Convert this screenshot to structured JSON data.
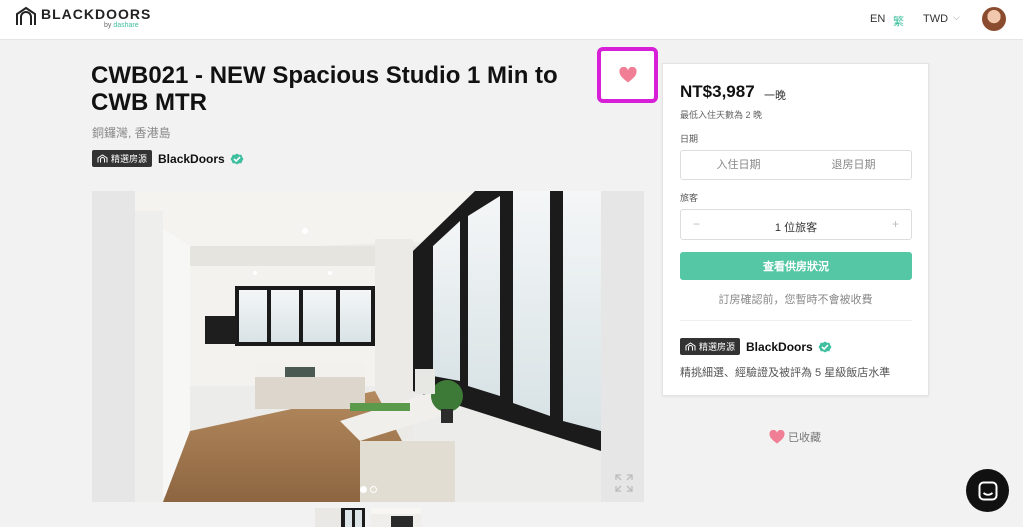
{
  "header": {
    "logo_main": "BLACKDOORS",
    "logo_by": "by ",
    "logo_brand": "dashare",
    "language": "EN",
    "language_alt": "繁",
    "currency": "TWD",
    "currency_caret": "⌵"
  },
  "listing": {
    "title": "CWB021 - NEW Spacious Studio 1 Min to CWB MTR",
    "location": "銅鑼灣, 香港島",
    "badge": "精選房源",
    "host": "BlackDoors"
  },
  "gallery": {
    "photo_count": 2,
    "current_photo": 1
  },
  "booking": {
    "price": "NT$3,987",
    "per": "一晚",
    "min_stay": "最低入住天數為 2 晚",
    "date_label": "日期",
    "checkin_placeholder": "入住日期",
    "checkout_placeholder": "退房日期",
    "guests_label": "旅客",
    "guest_minus": "−",
    "guest_value": "1 位旅客",
    "guest_plus": "+",
    "check_button": "查看供房狀況",
    "note": "訂房確認前，您暫時不會被收費",
    "badge": "精選房源",
    "host": "BlackDoors",
    "host_description": "精挑細選、經驗證及被評為 5 星級飯店水準"
  },
  "saved_label": "已收藏",
  "colors": {
    "accent": "#55c7a4",
    "favorite_highlight": "#d61fd6",
    "heart": "#f07f95"
  }
}
